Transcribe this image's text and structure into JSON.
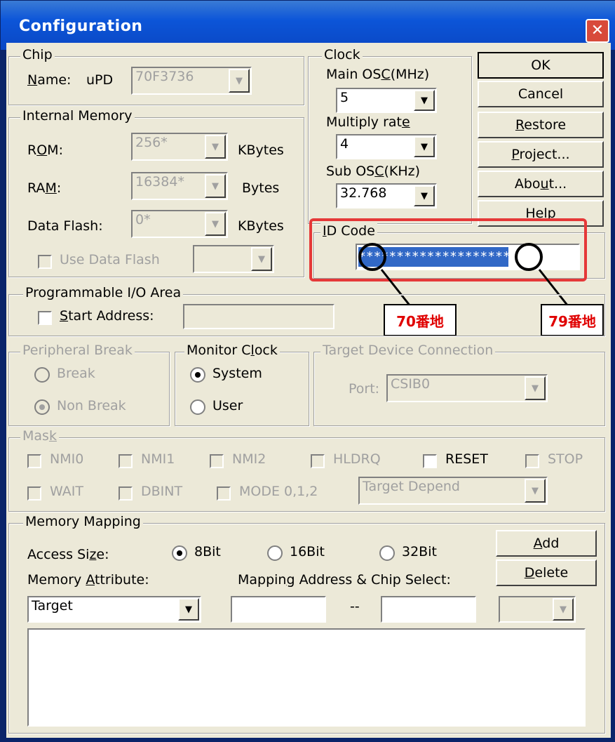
{
  "window": {
    "title": "Configuration"
  },
  "chip": {
    "group_label": "Chip",
    "name_label": "Name:",
    "name_prefix": "uPD",
    "name_value": "70F3736"
  },
  "internal_memory": {
    "group_label": "Internal Memory",
    "rom_label": "ROM:",
    "rom_value": "256*",
    "rom_unit": "KBytes",
    "ram_label": "RAM:",
    "ram_value": "16384*",
    "ram_unit": "Bytes",
    "dataflash_label": "Data Flash:",
    "dataflash_value": "0*",
    "dataflash_unit": "KBytes",
    "use_data_flash_label": "Use Data Flash"
  },
  "clock": {
    "group_label": "Clock",
    "main_osc_label": "Main OSC(MHz)",
    "main_osc_value": "5",
    "multiply_label": "Multiply rate",
    "multiply_value": "4",
    "sub_osc_label": "Sub OSC(KHz)",
    "sub_osc_value": "32.768"
  },
  "buttons": {
    "ok": "OK",
    "cancel": "Cancel",
    "restore": "Restore",
    "project": "Project...",
    "about": "About...",
    "help": "Help"
  },
  "id_code": {
    "group_label": "ID Code",
    "value": "********************",
    "annotation_left": "70番地",
    "annotation_right": "79番地",
    "highlight_color": "#e53838"
  },
  "prog_io": {
    "group_label": "Programmable I/O Area",
    "start_address_label": "Start Address:"
  },
  "peripheral_break": {
    "group_label": "Peripheral Break",
    "break_label": "Break",
    "non_break_label": "Non Break",
    "selected": "Non Break"
  },
  "monitor_clock": {
    "group_label": "Monitor Clock",
    "system_label": "System",
    "user_label": "User",
    "selected": "System"
  },
  "target_device": {
    "group_label": "Target Device Connection",
    "port_label": "Port:",
    "port_value": "CSIB0"
  },
  "mask": {
    "group_label": "Mask",
    "row1": [
      "NMI0",
      "NMI1",
      "NMI2",
      "HLDRQ",
      "RESET",
      "STOP"
    ],
    "row2": [
      "WAIT",
      "DBINT",
      "MODE 0,1,2"
    ],
    "target_depend_value": "Target Depend"
  },
  "memory_mapping": {
    "group_label": "Memory Mapping",
    "access_size_label": "Access Size:",
    "options": [
      "8Bit",
      "16Bit",
      "32Bit"
    ],
    "selected": "8Bit",
    "add_label": "Add",
    "delete_label": "Delete",
    "memory_attribute_label": "Memory Attribute:",
    "mapping_address_label": "Mapping Address & Chip Select:",
    "memory_attribute_value": "Target",
    "range_separator": "--"
  },
  "colors": {
    "title_bar": "#0a47c4",
    "selection": "#3168c6",
    "annotation_text": "#e00000"
  }
}
